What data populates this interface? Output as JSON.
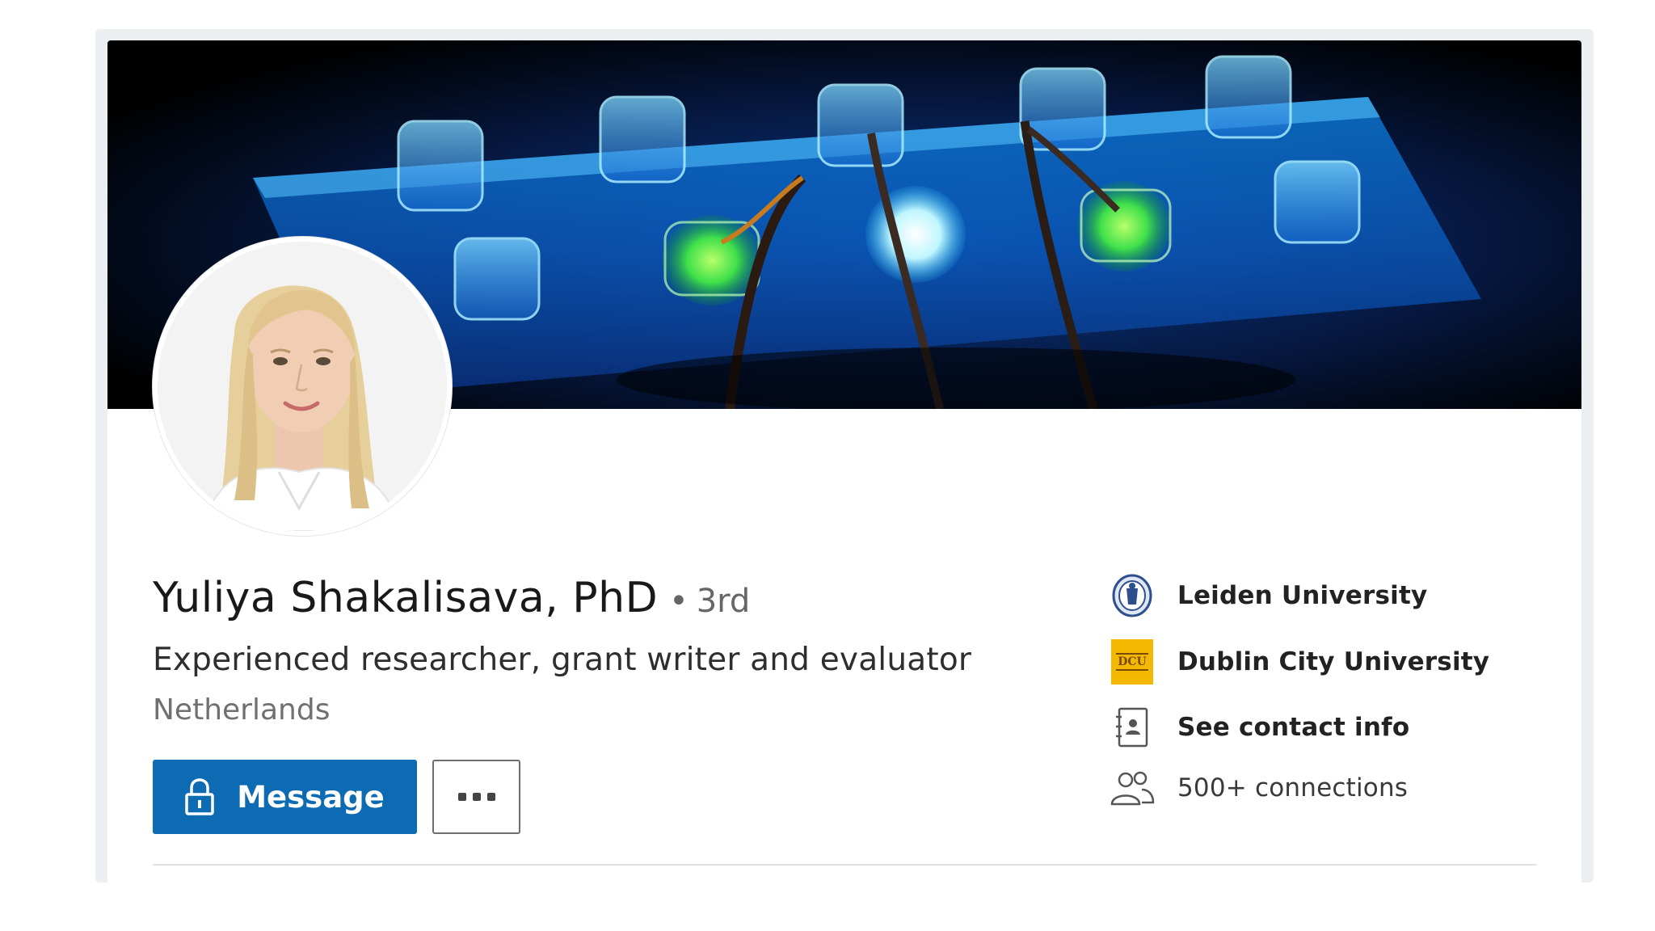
{
  "profile": {
    "name": "Yuliya Shakalisava, PhD",
    "degree_separator": "•",
    "degree": "3rd",
    "headline": "Experienced researcher, grant writer and evaluator",
    "location": "Netherlands"
  },
  "actions": {
    "message_label": "Message",
    "more_label": "···"
  },
  "sidebar": {
    "items": [
      {
        "label": "Leiden University",
        "icon": "leiden-university-seal-icon"
      },
      {
        "label": "Dublin City University",
        "icon": "dcu-logo-icon",
        "logo_text": "DCU"
      },
      {
        "label": "See contact info",
        "icon": "contact-card-icon"
      },
      {
        "label": "500+ connections",
        "icon": "people-icon"
      }
    ]
  },
  "colors": {
    "primary": "#0d6bb4",
    "text": "#191919",
    "muted": "#666666",
    "dcu_gold": "#f5b800"
  }
}
